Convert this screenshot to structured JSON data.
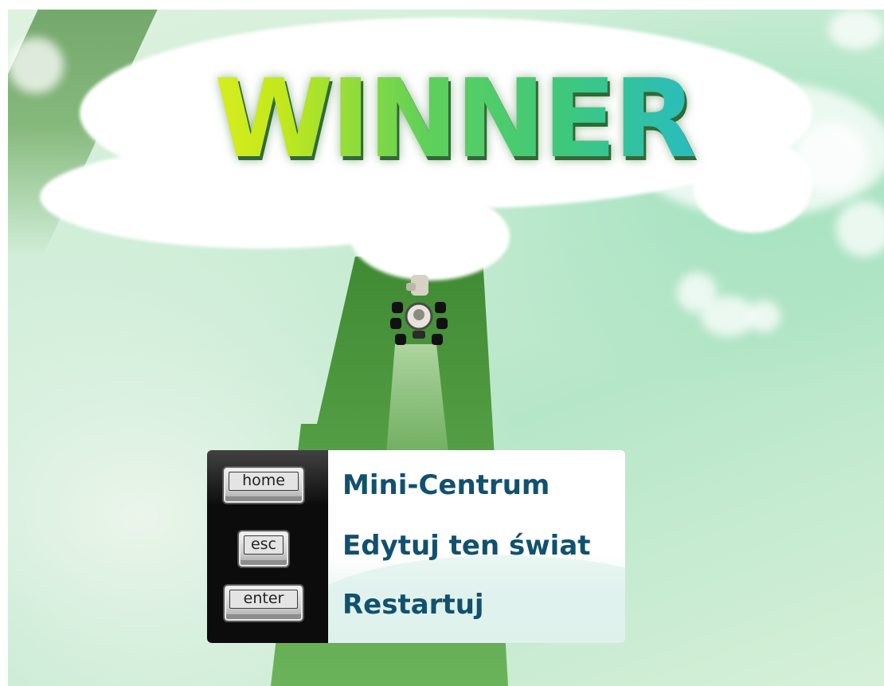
{
  "title": "WINNER",
  "menu": {
    "items": [
      {
        "key": "home",
        "label": "Mini-Centrum"
      },
      {
        "key": "esc",
        "label": "Edytuj ten świat"
      },
      {
        "key": "enter",
        "label": "Restartuj"
      }
    ]
  },
  "colors": {
    "label_text": "#11516f",
    "title_gradient_start": "#e6f020",
    "title_gradient_end": "#22b7d8",
    "road": "#4f9a3c"
  },
  "icons": {
    "robot": "robot-vehicle-icon"
  }
}
